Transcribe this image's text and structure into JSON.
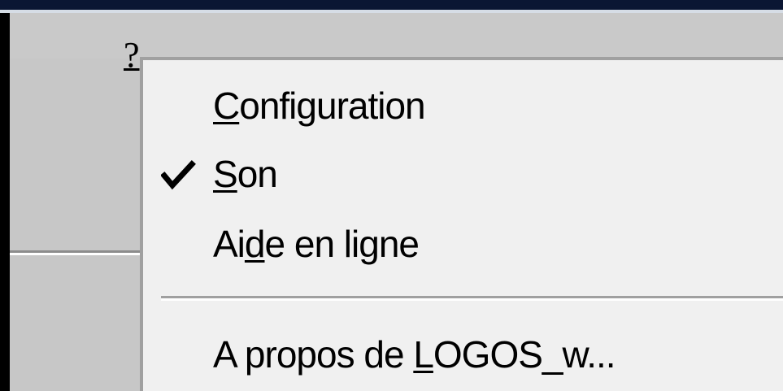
{
  "menubar": {
    "help_menu": {
      "label": "?"
    }
  },
  "dropdown": {
    "items": [
      {
        "before": "",
        "accel": "C",
        "after": "onfiguration",
        "checked": false
      },
      {
        "before": "",
        "accel": "S",
        "after": "on",
        "checked": true
      },
      {
        "before": "Ai",
        "accel": "d",
        "after": "e en ligne",
        "checked": false
      },
      {
        "before": "A propos de ",
        "accel": "L",
        "after": "OGOS_w...",
        "checked": false
      }
    ]
  },
  "colors": {
    "menu_background": "#f0f0f0",
    "window_background": "#c7c7c7",
    "title_strip": "#0a1633"
  },
  "icons": {
    "check": "checkmark-icon"
  }
}
